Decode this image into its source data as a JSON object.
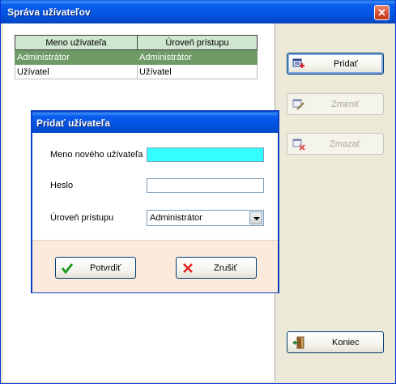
{
  "window": {
    "title": "Správa užívateľov",
    "close_glyph": "✕"
  },
  "table": {
    "headers": [
      "Meno užívateľa",
      "Úroveň prístupu"
    ],
    "rows": [
      [
        "Administrátor",
        "Administrátor"
      ],
      [
        "Užívatel",
        "Užívatel"
      ]
    ],
    "selected_row": 0
  },
  "actions": {
    "add_label": "Pridať",
    "edit_label": "Zmeniť",
    "delete_label": "Zmazať",
    "close_label": "Koniec"
  },
  "dialog": {
    "title": "Pridať užívateľa",
    "username_label": "Meno nového užívateľa",
    "username_value": "",
    "password_label": "Heslo",
    "password_value": "",
    "level_label": "Úroveň prístupu",
    "level_value": "Administrátor",
    "confirm_label": "Potvrdiť",
    "cancel_label": "Zrušiť"
  },
  "colors": {
    "titlebar": "#0353e1",
    "header_bg": "#cfe6cf",
    "selected_row": "#6e9a66",
    "active_field": "#33ffff",
    "footer_bg": "#fcebdc"
  }
}
